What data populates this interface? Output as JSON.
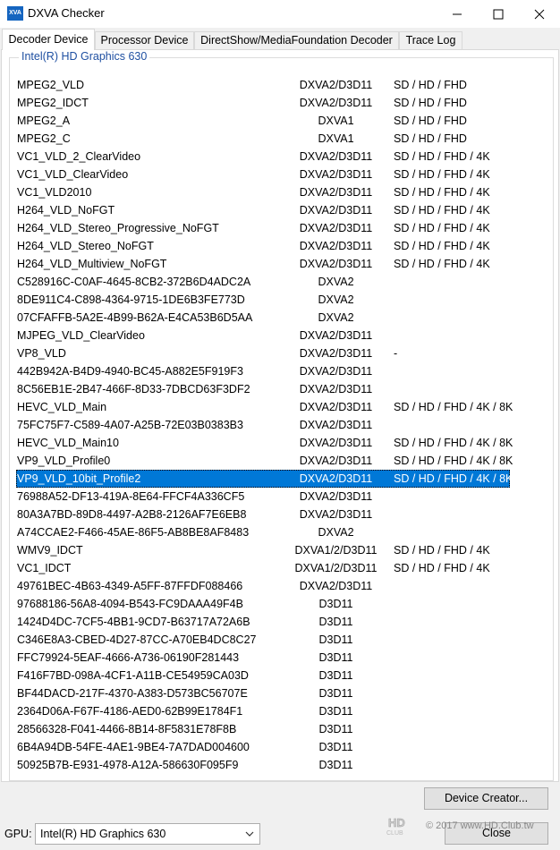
{
  "window": {
    "title": "DXVA Checker",
    "icon_text": "XVA"
  },
  "tabs": [
    {
      "label": "Decoder Device"
    },
    {
      "label": "Processor Device"
    },
    {
      "label": "DirectShow/MediaFoundation Decoder"
    },
    {
      "label": "Trace Log"
    }
  ],
  "group_label": "Intel(R) HD Graphics 630",
  "decoders": [
    [
      "MPEG2_VLD",
      "DXVA2/D3D11",
      "SD / HD / FHD"
    ],
    [
      "MPEG2_IDCT",
      "DXVA2/D3D11",
      "SD / HD / FHD"
    ],
    [
      "MPEG2_A",
      "DXVA1",
      "SD / HD / FHD"
    ],
    [
      "MPEG2_C",
      "DXVA1",
      "SD / HD / FHD"
    ],
    [
      "VC1_VLD_2_ClearVideo",
      "DXVA2/D3D11",
      "SD / HD / FHD / 4K"
    ],
    [
      "VC1_VLD_ClearVideo",
      "DXVA2/D3D11",
      "SD / HD / FHD / 4K"
    ],
    [
      "VC1_VLD2010",
      "DXVA2/D3D11",
      "SD / HD / FHD / 4K"
    ],
    [
      "H264_VLD_NoFGT",
      "DXVA2/D3D11",
      "SD / HD / FHD / 4K"
    ],
    [
      "H264_VLD_Stereo_Progressive_NoFGT",
      "DXVA2/D3D11",
      "SD / HD / FHD / 4K"
    ],
    [
      "H264_VLD_Stereo_NoFGT",
      "DXVA2/D3D11",
      "SD / HD / FHD / 4K"
    ],
    [
      "H264_VLD_Multiview_NoFGT",
      "DXVA2/D3D11",
      "SD / HD / FHD / 4K"
    ],
    [
      "C528916C-C0AF-4645-8CB2-372B6D4ADC2A",
      "DXVA2",
      ""
    ],
    [
      "8DE911C4-C898-4364-9715-1DE6B3FE773D",
      "DXVA2",
      ""
    ],
    [
      "07CFAFFB-5A2E-4B99-B62A-E4CA53B6D5AA",
      "DXVA2",
      ""
    ],
    [
      "MJPEG_VLD_ClearVideo",
      "DXVA2/D3D11",
      ""
    ],
    [
      "VP8_VLD",
      "DXVA2/D3D11",
      "-"
    ],
    [
      "442B942A-B4D9-4940-BC45-A882E5F919F3",
      "DXVA2/D3D11",
      ""
    ],
    [
      "8C56EB1E-2B47-466F-8D33-7DBCD63F3DF2",
      "DXVA2/D3D11",
      ""
    ],
    [
      "HEVC_VLD_Main",
      "DXVA2/D3D11",
      "SD / HD / FHD / 4K / 8K"
    ],
    [
      "75FC75F7-C589-4A07-A25B-72E03B0383B3",
      "DXVA2/D3D11",
      ""
    ],
    [
      "HEVC_VLD_Main10",
      "DXVA2/D3D11",
      "SD / HD / FHD / 4K / 8K"
    ],
    [
      "VP9_VLD_Profile0",
      "DXVA2/D3D11",
      "SD / HD / FHD / 4K / 8K"
    ],
    [
      "VP9_VLD_10bit_Profile2",
      "DXVA2/D3D11",
      "SD / HD / FHD / 4K / 8K"
    ],
    [
      "76988A52-DF13-419A-8E64-FFCF4A336CF5",
      "DXVA2/D3D11",
      ""
    ],
    [
      "80A3A7BD-89D8-4497-A2B8-2126AF7E6EB8",
      "DXVA2/D3D11",
      ""
    ],
    [
      "A74CCAE2-F466-45AE-86F5-AB8BE8AF8483",
      "DXVA2",
      ""
    ],
    [
      "WMV9_IDCT",
      "DXVA1/2/D3D11",
      "SD / HD / FHD / 4K"
    ],
    [
      "VC1_IDCT",
      "DXVA1/2/D3D11",
      "SD / HD / FHD / 4K"
    ],
    [
      "49761BEC-4B63-4349-A5FF-87FFDF088466",
      "DXVA2/D3D11",
      ""
    ],
    [
      "97688186-56A8-4094-B543-FC9DAAA49F4B",
      "D3D11",
      ""
    ],
    [
      "1424D4DC-7CF5-4BB1-9CD7-B63717A72A6B",
      "D3D11",
      ""
    ],
    [
      "C346E8A3-CBED-4D27-87CC-A70EB4DC8C27",
      "D3D11",
      ""
    ],
    [
      "FFC79924-5EAF-4666-A736-06190F281443",
      "D3D11",
      ""
    ],
    [
      "F416F7BD-098A-4CF1-A11B-CE54959CA03D",
      "D3D11",
      ""
    ],
    [
      "BF44DACD-217F-4370-A383-D573BC56707E",
      "D3D11",
      ""
    ],
    [
      "2364D06A-F67F-4186-AED0-62B99E1784F1",
      "D3D11",
      ""
    ],
    [
      "28566328-F041-4466-8B14-8F5831E78F8B",
      "D3D11",
      ""
    ],
    [
      "6B4A94DB-54FE-4AE1-9BE4-7A7DAD004600",
      "D3D11",
      ""
    ],
    [
      "50925B7B-E931-4978-A12A-586630F095F9",
      "D3D11",
      ""
    ]
  ],
  "selected_row": 22,
  "buttons": {
    "device_creator": "Device Creator...",
    "close": "Close"
  },
  "gpu": {
    "label": "GPU:",
    "selected": "Intel(R) HD Graphics 630"
  },
  "watermark": {
    "logo_text": "HD CLUB",
    "text": "© 2017 www.HD.Club.tw"
  },
  "colors": {
    "selection": "#0078d7",
    "group_label": "#1e4fa1",
    "app_icon": "#1565c0"
  }
}
